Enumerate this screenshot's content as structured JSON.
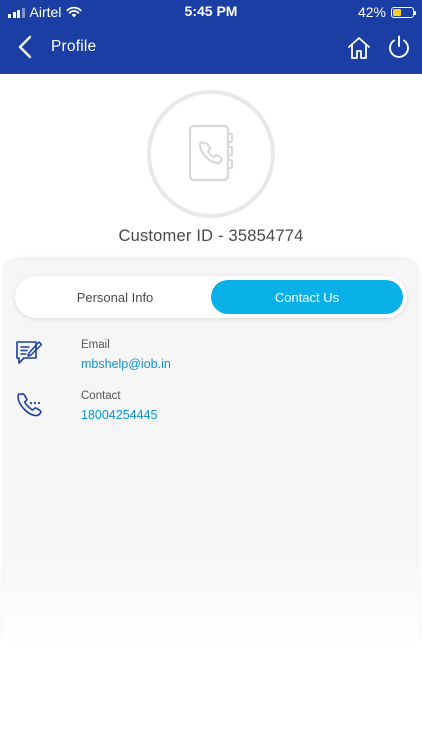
{
  "status_bar": {
    "carrier": "Airtel",
    "time": "5:45 PM",
    "battery_percent": "42%",
    "battery_level": 0.42
  },
  "nav": {
    "title": "Profile"
  },
  "profile": {
    "customer_id": "Customer ID - 35854774"
  },
  "tabs": [
    {
      "label": "Personal Info",
      "active": false
    },
    {
      "label": "Contact Us",
      "active": true
    }
  ],
  "contact": {
    "email": {
      "label": "Email",
      "value": "mbshelp@iob.in"
    },
    "phone": {
      "label": "Contact",
      "value": "18004254445"
    }
  },
  "colors": {
    "header_bg": "#1a3ea4",
    "accent": "#0ab0e8",
    "link": "#0a94cf",
    "icon": "#1a3ea4"
  }
}
